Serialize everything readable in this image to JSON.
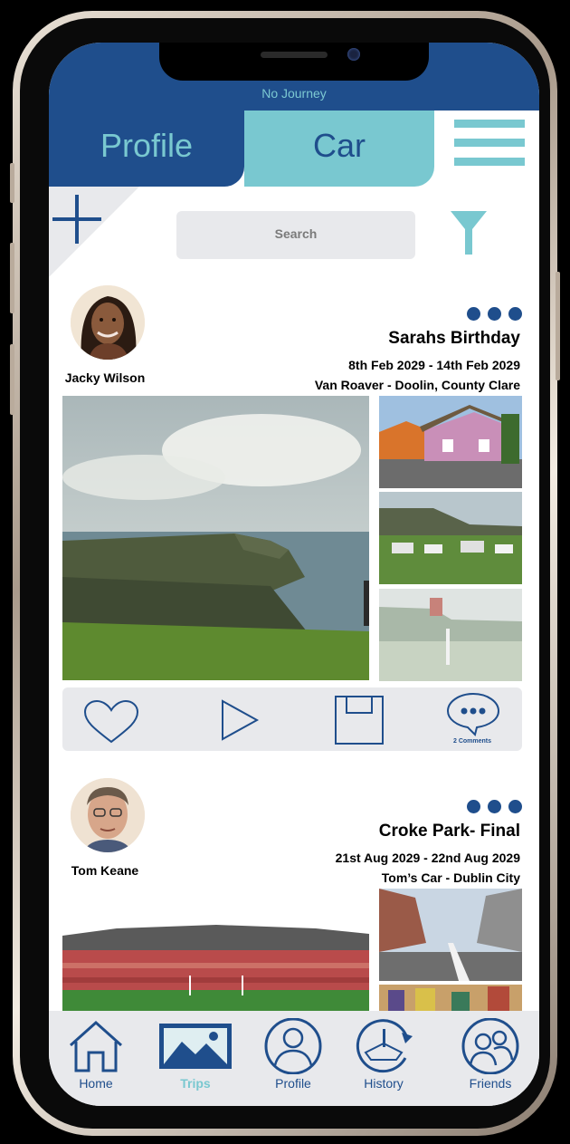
{
  "header": {
    "journey_status": "No Journey",
    "tabs": [
      {
        "label": "Profile",
        "active": false
      },
      {
        "label": "Car",
        "active": true
      }
    ]
  },
  "search": {
    "placeholder": "Search"
  },
  "colors": {
    "primary": "#1f4e8c",
    "accent": "#79c8d0",
    "panel": "#e8e9ec"
  },
  "posts": [
    {
      "author": "Jacky Wilson",
      "title": "Sarahs Birthday",
      "dates": "8th Feb 2029 - 14th Feb 2029",
      "route": "Van Roaver - Doolin, County Clare",
      "photos": [
        "cliffs-of-moher",
        "doolin-cottages",
        "campsite-by-cliffs",
        "misty-coast"
      ],
      "comments_count": "2 Comments"
    },
    {
      "author": "Tom Keane",
      "title": "Croke Park- Final",
      "dates": "21st Aug 2029 - 22nd Aug 2029",
      "route": "Tom’s Car - Dublin City",
      "photos": [
        "croke-park-stadium",
        "dublin-street",
        "dublin-shopfronts"
      ]
    }
  ],
  "nav": {
    "items": [
      {
        "label": "Home",
        "icon": "house-icon",
        "active": false
      },
      {
        "label": "Trips",
        "icon": "image-icon",
        "active": true
      },
      {
        "label": "Profile",
        "icon": "person-icon",
        "active": false
      },
      {
        "label": "History",
        "icon": "history-icon",
        "active": false
      },
      {
        "label": "Friends",
        "icon": "friends-icon",
        "active": false
      }
    ]
  }
}
